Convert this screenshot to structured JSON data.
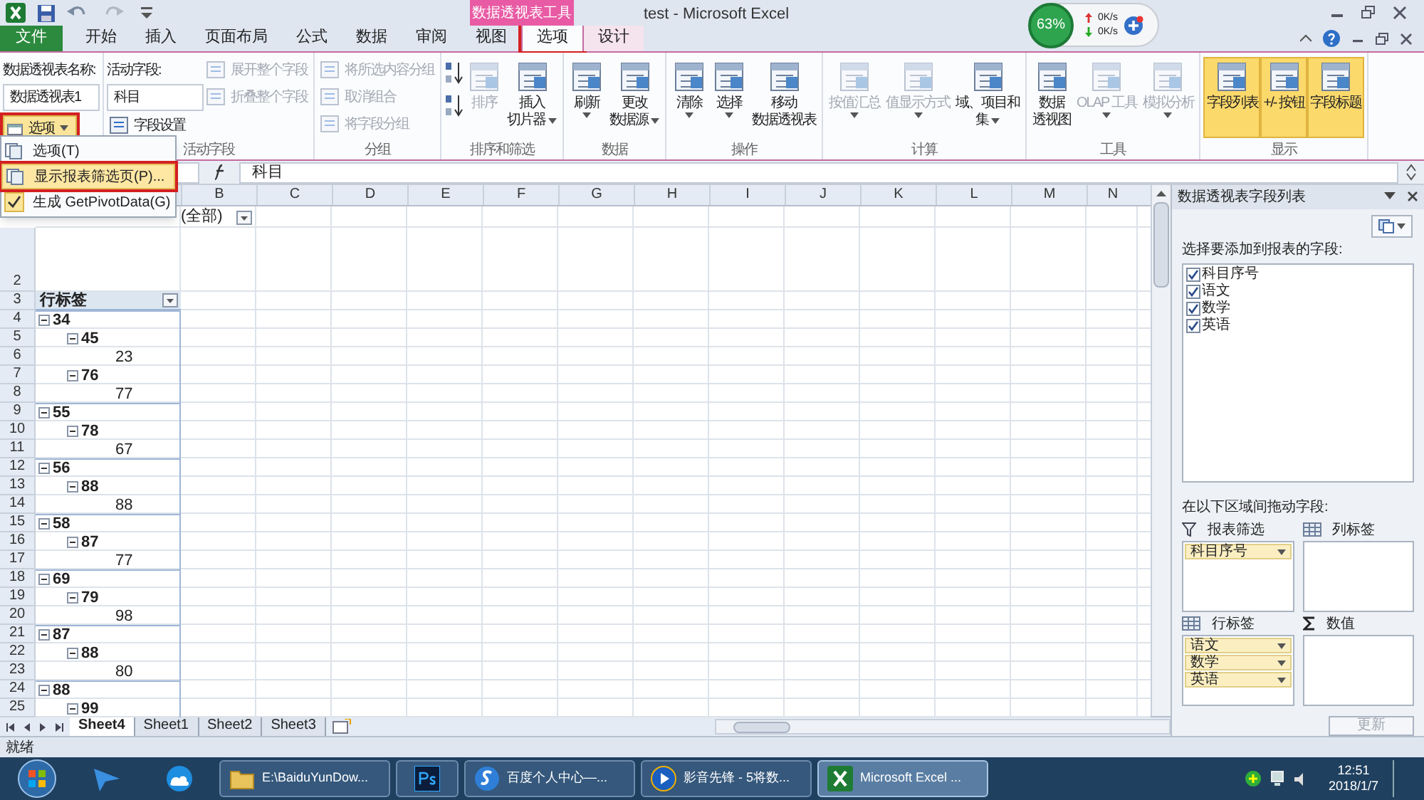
{
  "window": {
    "title": "test - Microsoft Excel",
    "context_group": "数据透视表工具"
  },
  "net_widget": {
    "percent": "63%",
    "upload": "0K/s",
    "download": "0K/s"
  },
  "tabs": [
    {
      "label": "文件",
      "kind": "file",
      "selected": false,
      "annotated": false
    },
    {
      "label": "开始",
      "kind": "normal",
      "selected": false,
      "annotated": false
    },
    {
      "label": "插入",
      "kind": "normal",
      "selected": false,
      "annotated": false
    },
    {
      "label": "页面布局",
      "kind": "normal",
      "selected": false,
      "annotated": false
    },
    {
      "label": "公式",
      "kind": "normal",
      "selected": false,
      "annotated": false
    },
    {
      "label": "数据",
      "kind": "normal",
      "selected": false,
      "annotated": false
    },
    {
      "label": "审阅",
      "kind": "normal",
      "selected": false,
      "annotated": false
    },
    {
      "label": "视图",
      "kind": "normal",
      "selected": false,
      "annotated": false
    },
    {
      "label": "选项",
      "kind": "context",
      "selected": true,
      "annotated": true
    },
    {
      "label": "设计",
      "kind": "context",
      "selected": false,
      "annotated": false
    }
  ],
  "ribbon_groups": [
    {
      "columns": [
        [
          {
            "kind": "caption",
            "text": "数据透视表名称:"
          },
          {
            "kind": "field",
            "value": "数据透视表1"
          },
          {
            "kind": "split",
            "label": "选项",
            "annotated": true
          }
        ]
      ]
    },
    {
      "label": "活动字段",
      "columns": [
        [
          {
            "kind": "caption",
            "text": "活动字段:"
          },
          {
            "kind": "field",
            "value": "科目"
          },
          {
            "kind": "small",
            "label": "字段设置",
            "disabled": false
          }
        ],
        [
          {
            "kind": "small",
            "label": "展开整个字段",
            "disabled": true
          },
          {
            "kind": "small",
            "label": "折叠整个字段",
            "disabled": true
          }
        ]
      ]
    },
    {
      "label": "分组",
      "columns": [
        [
          {
            "kind": "small",
            "label": "将所选内容分组",
            "disabled": true
          },
          {
            "kind": "small",
            "label": "取消组合",
            "disabled": true
          },
          {
            "kind": "small",
            "label": "将字段分组",
            "disabled": true
          }
        ]
      ]
    },
    {
      "label": "排序和筛选",
      "columns": [
        [
          {
            "kind": "icon_button",
            "disabled": false
          },
          {
            "kind": "icon_button",
            "disabled": false
          }
        ],
        [
          {
            "kind": "large",
            "lines": [
              "排序"
            ],
            "disabled": true,
            "on": false,
            "dropdown": false
          }
        ],
        [
          {
            "kind": "large",
            "lines": [
              "插入",
              "切片器"
            ],
            "disabled": false,
            "on": false,
            "dropdown": true
          }
        ]
      ]
    },
    {
      "label": "数据",
      "columns": [
        [
          {
            "kind": "large",
            "lines": [
              "刷新"
            ],
            "disabled": false,
            "on": false,
            "dropdown": true
          }
        ],
        [
          {
            "kind": "large",
            "lines": [
              "更改",
              "数据源"
            ],
            "disabled": false,
            "on": false,
            "dropdown": true
          }
        ]
      ]
    },
    {
      "label": "操作",
      "columns": [
        [
          {
            "kind": "large",
            "lines": [
              "清除"
            ],
            "disabled": false,
            "on": false,
            "dropdown": true
          }
        ],
        [
          {
            "kind": "large",
            "lines": [
              "选择"
            ],
            "disabled": false,
            "on": false,
            "dropdown": true
          }
        ],
        [
          {
            "kind": "large",
            "lines": [
              "移动",
              "数据透视表"
            ],
            "disabled": false,
            "on": false,
            "dropdown": false
          }
        ]
      ]
    },
    {
      "label": "计算",
      "columns": [
        [
          {
            "kind": "large",
            "lines": [
              "按值汇总"
            ],
            "disabled": true,
            "on": false,
            "dropdown": true
          }
        ],
        [
          {
            "kind": "large",
            "lines": [
              "值显示方式"
            ],
            "disabled": true,
            "on": false,
            "dropdown": true
          }
        ],
        [
          {
            "kind": "large",
            "lines": [
              "域、项目和",
              "集"
            ],
            "disabled": false,
            "on": false,
            "dropdown": true
          }
        ]
      ]
    },
    {
      "label": "工具",
      "columns": [
        [
          {
            "kind": "large",
            "lines": [
              "数据",
              "透视图"
            ],
            "disabled": false,
            "on": false,
            "dropdown": false
          }
        ],
        [
          {
            "kind": "large",
            "lines": [
              "OLAP 工具"
            ],
            "disabled": true,
            "on": false,
            "dropdown": true
          }
        ],
        [
          {
            "kind": "large",
            "lines": [
              "模拟分析"
            ],
            "disabled": true,
            "on": false,
            "dropdown": true
          }
        ]
      ]
    },
    {
      "label": "显示",
      "columns": [
        [
          {
            "kind": "large",
            "lines": [
              "字段列表"
            ],
            "disabled": false,
            "on": true,
            "dropdown": false
          }
        ],
        [
          {
            "kind": "large",
            "lines": [
              "+/- 按钮"
            ],
            "disabled": false,
            "on": true,
            "dropdown": false
          }
        ],
        [
          {
            "kind": "large",
            "lines": [
              "字段标题"
            ],
            "disabled": false,
            "on": true,
            "dropdown": false
          }
        ]
      ]
    }
  ],
  "options_menu": [
    {
      "label": "选项(T)",
      "selected": false,
      "checked": false,
      "annotated": false
    },
    {
      "label": "显示报表筛选页(P)...",
      "selected": true,
      "checked": false,
      "annotated": true
    },
    {
      "label": "生成 GetPivotData(G)",
      "selected": false,
      "checked": true,
      "annotated": false
    }
  ],
  "formula_bar": {
    "value": "科目"
  },
  "sheet": {
    "columns": [
      "B",
      "C",
      "D",
      "E",
      "F",
      "G",
      "H",
      "I",
      "J",
      "K",
      "L",
      "M",
      "N"
    ],
    "row_numbers": [
      "2",
      "3",
      "4",
      "5",
      "6",
      "7",
      "8",
      "9",
      "10",
      "11",
      "12",
      "13",
      "14",
      "15",
      "16",
      "17",
      "18",
      "19",
      "20",
      "21",
      "22",
      "23",
      "24",
      "25"
    ],
    "report_filter_value": "(全部)",
    "row_labels_header": "行标签",
    "pivot_rows": [
      {
        "label": "34",
        "expanded": true,
        "children": [
          {
            "label": "45",
            "expanded": true,
            "children": [
              {
                "label": "23"
              }
            ]
          },
          {
            "label": "76",
            "expanded": true,
            "children": [
              {
                "label": "77"
              }
            ]
          }
        ]
      },
      {
        "label": "55",
        "expanded": true,
        "children": [
          {
            "label": "78",
            "expanded": true,
            "children": [
              {
                "label": "67"
              }
            ]
          }
        ]
      },
      {
        "label": "56",
        "expanded": true,
        "children": [
          {
            "label": "88",
            "expanded": true,
            "children": [
              {
                "label": "88"
              }
            ]
          }
        ]
      },
      {
        "label": "58",
        "expanded": true,
        "children": [
          {
            "label": "87",
            "expanded": true,
            "children": [
              {
                "label": "77"
              }
            ]
          }
        ]
      },
      {
        "label": "69",
        "expanded": true,
        "children": [
          {
            "label": "79",
            "expanded": true,
            "children": [
              {
                "label": "98"
              }
            ]
          }
        ]
      },
      {
        "label": "87",
        "expanded": true,
        "children": [
          {
            "label": "88",
            "expanded": true,
            "children": [
              {
                "label": "80"
              }
            ]
          }
        ]
      },
      {
        "label": "88",
        "expanded": true,
        "children": [
          {
            "label": "99",
            "expanded": true
          }
        ]
      }
    ]
  },
  "field_list": {
    "title": "数据透视表字段列表",
    "choose_label": "选择要添加到报表的字段:",
    "fields": [
      {
        "label": "科目序号",
        "checked": true
      },
      {
        "label": "语文",
        "checked": true
      },
      {
        "label": "数学",
        "checked": true
      },
      {
        "label": "英语",
        "checked": true
      }
    ],
    "drag_label": "在以下区域间拖动字段:",
    "areas": [
      {
        "kind": "filter",
        "label": "报表筛选",
        "fields": [
          "科目序号"
        ]
      },
      {
        "kind": "columns",
        "label": "列标签"
      },
      {
        "kind": "rows",
        "label": "行标签",
        "fields": [
          "语文",
          "数学",
          "英语"
        ]
      },
      {
        "kind": "values",
        "label": "数值"
      }
    ],
    "update_button": {
      "label": "更新",
      "disabled": true
    }
  },
  "sheet_tabs": [
    {
      "label": "Sheet4",
      "selected": true
    },
    {
      "label": "Sheet1",
      "selected": false
    },
    {
      "label": "Sheet2",
      "selected": false
    },
    {
      "label": "Sheet3",
      "selected": false
    }
  ],
  "status_bar": {
    "text": "就绪"
  },
  "taskbar": {
    "tasks": [
      {
        "kind": "folder",
        "label": "E:\\BaiduYunDow...",
        "active": false
      },
      {
        "kind": "photoshop",
        "active": false
      },
      {
        "kind": "browser",
        "label": "百度个人中心—...",
        "active": false
      },
      {
        "kind": "player",
        "label": "影音先锋 - 5将数...",
        "active": false
      },
      {
        "kind": "excel",
        "label": "Microsoft Excel ...",
        "active": true
      }
    ],
    "time": "12:51",
    "date": "2018/1/7"
  }
}
